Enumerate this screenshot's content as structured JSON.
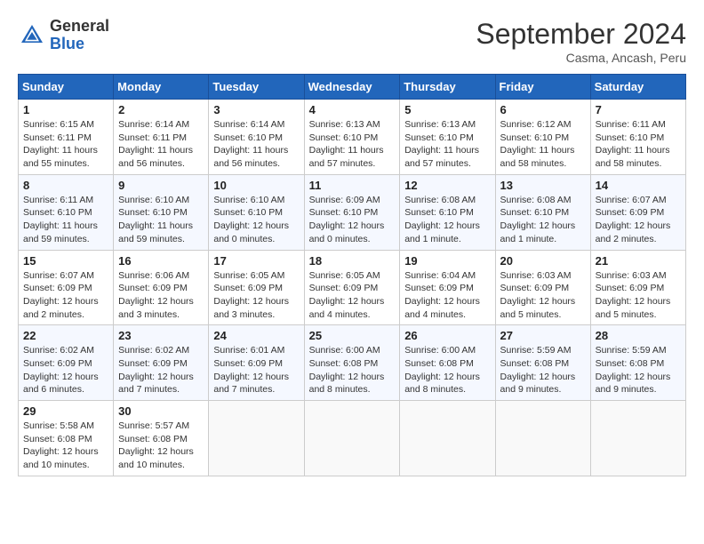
{
  "header": {
    "logo_general": "General",
    "logo_blue": "Blue",
    "title": "September 2024",
    "subtitle": "Casma, Ancash, Peru"
  },
  "days_of_week": [
    "Sunday",
    "Monday",
    "Tuesday",
    "Wednesday",
    "Thursday",
    "Friday",
    "Saturday"
  ],
  "weeks": [
    [
      {
        "day": "1",
        "sunrise": "6:15 AM",
        "sunset": "6:11 PM",
        "daylight": "11 hours and 55 minutes."
      },
      {
        "day": "2",
        "sunrise": "6:14 AM",
        "sunset": "6:11 PM",
        "daylight": "11 hours and 56 minutes."
      },
      {
        "day": "3",
        "sunrise": "6:14 AM",
        "sunset": "6:10 PM",
        "daylight": "11 hours and 56 minutes."
      },
      {
        "day": "4",
        "sunrise": "6:13 AM",
        "sunset": "6:10 PM",
        "daylight": "11 hours and 57 minutes."
      },
      {
        "day": "5",
        "sunrise": "6:13 AM",
        "sunset": "6:10 PM",
        "daylight": "11 hours and 57 minutes."
      },
      {
        "day": "6",
        "sunrise": "6:12 AM",
        "sunset": "6:10 PM",
        "daylight": "11 hours and 58 minutes."
      },
      {
        "day": "7",
        "sunrise": "6:11 AM",
        "sunset": "6:10 PM",
        "daylight": "11 hours and 58 minutes."
      }
    ],
    [
      {
        "day": "8",
        "sunrise": "6:11 AM",
        "sunset": "6:10 PM",
        "daylight": "11 hours and 59 minutes."
      },
      {
        "day": "9",
        "sunrise": "6:10 AM",
        "sunset": "6:10 PM",
        "daylight": "11 hours and 59 minutes."
      },
      {
        "day": "10",
        "sunrise": "6:10 AM",
        "sunset": "6:10 PM",
        "daylight": "12 hours and 0 minutes."
      },
      {
        "day": "11",
        "sunrise": "6:09 AM",
        "sunset": "6:10 PM",
        "daylight": "12 hours and 0 minutes."
      },
      {
        "day": "12",
        "sunrise": "6:08 AM",
        "sunset": "6:10 PM",
        "daylight": "12 hours and 1 minute."
      },
      {
        "day": "13",
        "sunrise": "6:08 AM",
        "sunset": "6:10 PM",
        "daylight": "12 hours and 1 minute."
      },
      {
        "day": "14",
        "sunrise": "6:07 AM",
        "sunset": "6:09 PM",
        "daylight": "12 hours and 2 minutes."
      }
    ],
    [
      {
        "day": "15",
        "sunrise": "6:07 AM",
        "sunset": "6:09 PM",
        "daylight": "12 hours and 2 minutes."
      },
      {
        "day": "16",
        "sunrise": "6:06 AM",
        "sunset": "6:09 PM",
        "daylight": "12 hours and 3 minutes."
      },
      {
        "day": "17",
        "sunrise": "6:05 AM",
        "sunset": "6:09 PM",
        "daylight": "12 hours and 3 minutes."
      },
      {
        "day": "18",
        "sunrise": "6:05 AM",
        "sunset": "6:09 PM",
        "daylight": "12 hours and 4 minutes."
      },
      {
        "day": "19",
        "sunrise": "6:04 AM",
        "sunset": "6:09 PM",
        "daylight": "12 hours and 4 minutes."
      },
      {
        "day": "20",
        "sunrise": "6:03 AM",
        "sunset": "6:09 PM",
        "daylight": "12 hours and 5 minutes."
      },
      {
        "day": "21",
        "sunrise": "6:03 AM",
        "sunset": "6:09 PM",
        "daylight": "12 hours and 5 minutes."
      }
    ],
    [
      {
        "day": "22",
        "sunrise": "6:02 AM",
        "sunset": "6:09 PM",
        "daylight": "12 hours and 6 minutes."
      },
      {
        "day": "23",
        "sunrise": "6:02 AM",
        "sunset": "6:09 PM",
        "daylight": "12 hours and 7 minutes."
      },
      {
        "day": "24",
        "sunrise": "6:01 AM",
        "sunset": "6:09 PM",
        "daylight": "12 hours and 7 minutes."
      },
      {
        "day": "25",
        "sunrise": "6:00 AM",
        "sunset": "6:08 PM",
        "daylight": "12 hours and 8 minutes."
      },
      {
        "day": "26",
        "sunrise": "6:00 AM",
        "sunset": "6:08 PM",
        "daylight": "12 hours and 8 minutes."
      },
      {
        "day": "27",
        "sunrise": "5:59 AM",
        "sunset": "6:08 PM",
        "daylight": "12 hours and 9 minutes."
      },
      {
        "day": "28",
        "sunrise": "5:59 AM",
        "sunset": "6:08 PM",
        "daylight": "12 hours and 9 minutes."
      }
    ],
    [
      {
        "day": "29",
        "sunrise": "5:58 AM",
        "sunset": "6:08 PM",
        "daylight": "12 hours and 10 minutes."
      },
      {
        "day": "30",
        "sunrise": "5:57 AM",
        "sunset": "6:08 PM",
        "daylight": "12 hours and 10 minutes."
      },
      null,
      null,
      null,
      null,
      null
    ]
  ]
}
